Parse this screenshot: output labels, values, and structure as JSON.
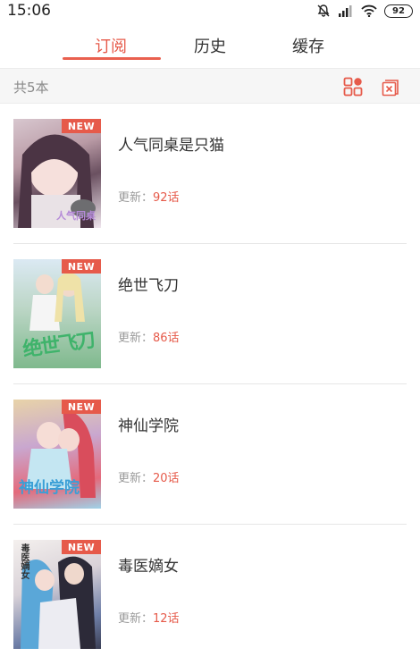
{
  "status_bar": {
    "time": "15:06",
    "battery": "92"
  },
  "tabs": [
    {
      "label": "订阅",
      "active": true
    },
    {
      "label": "历史",
      "active": false
    },
    {
      "label": "缓存",
      "active": false
    }
  ],
  "summary": {
    "count_label": "共5本"
  },
  "accent_color": "#e65a4a",
  "comics": [
    {
      "title": "人气同桌是只猫",
      "update_label": "更新：",
      "update_value": "92话",
      "tag": "NEW",
      "cover_logo": "人气同桌"
    },
    {
      "title": "绝世飞刀",
      "update_label": "更新：",
      "update_value": "86话",
      "tag": "NEW",
      "cover_logo": "绝世飞刀"
    },
    {
      "title": "神仙学院",
      "update_label": "更新：",
      "update_value": "20话",
      "tag": "NEW",
      "cover_logo": "神仙学院"
    },
    {
      "title": "毒医嫡女",
      "update_label": "更新：",
      "update_value": "12话",
      "tag": "NEW",
      "cover_logo": "毒医嫡女"
    }
  ]
}
